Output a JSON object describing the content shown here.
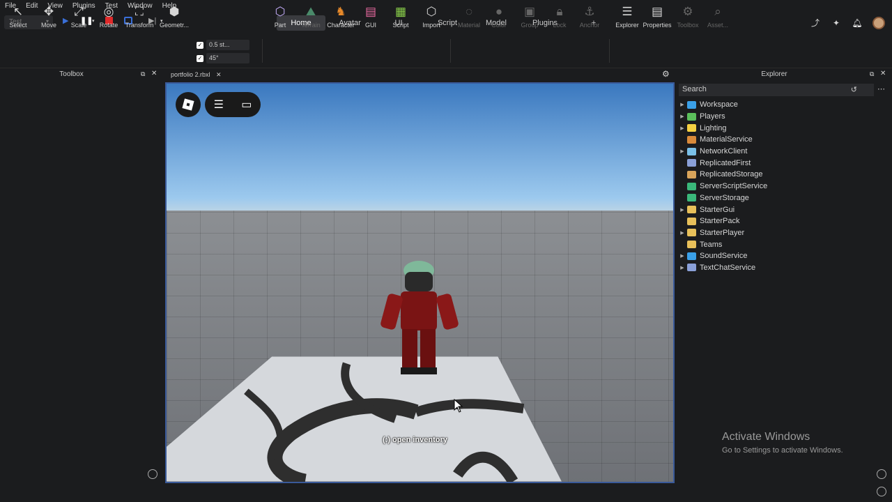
{
  "menu": [
    "File",
    "Edit",
    "View",
    "Plugins",
    "Test",
    "Window",
    "Help"
  ],
  "mode_select": "Test",
  "ribbon_tabs": [
    "Home",
    "Avatar",
    "UI",
    "Script",
    "Model",
    "Plugins"
  ],
  "ribbon_add": "+",
  "tools": {
    "select": "Select",
    "move": "Move",
    "scale": "Scale",
    "rotate": "Rotate",
    "transform": "Transform",
    "geometry": "Geometr...",
    "part": "Part",
    "terrain": "Terrain",
    "character": "Character",
    "gui": "GUI",
    "script": "Script",
    "import": "Import",
    "material": "Material",
    "color": "Color",
    "group": "Group",
    "lock": "Lock",
    "anchor": "Anchor",
    "explorer": "Explorer",
    "properties": "Properties",
    "toolbox": "Toolbox",
    "asset": "Asset..."
  },
  "snap": {
    "move_value": "0.5 st...",
    "rotate_value": "45°"
  },
  "toolbox_title": "Toolbox",
  "viewport_tab": "portfolio 2.rbxl",
  "viewport_prompt": "(:) open inventory",
  "explorer": {
    "title": "Explorer",
    "search_placeholder": "Search",
    "items": [
      {
        "label": "Workspace",
        "expandable": true,
        "color": "#3aa0e8"
      },
      {
        "label": "Players",
        "expandable": true,
        "color": "#5bbf5b"
      },
      {
        "label": "Lighting",
        "expandable": true,
        "color": "#f5d142"
      },
      {
        "label": "MaterialService",
        "expandable": false,
        "color": "#d98a3a"
      },
      {
        "label": "NetworkClient",
        "expandable": true,
        "color": "#7ac0e8"
      },
      {
        "label": "ReplicatedFirst",
        "expandable": false,
        "color": "#8aa0d8"
      },
      {
        "label": "ReplicatedStorage",
        "expandable": false,
        "color": "#d9a45a"
      },
      {
        "label": "ServerScriptService",
        "expandable": false,
        "color": "#3ab87a"
      },
      {
        "label": "ServerStorage",
        "expandable": false,
        "color": "#3ab87a"
      },
      {
        "label": "StarterGui",
        "expandable": true,
        "color": "#e8c05a"
      },
      {
        "label": "StarterPack",
        "expandable": false,
        "color": "#e8c05a"
      },
      {
        "label": "StarterPlayer",
        "expandable": true,
        "color": "#e8c05a"
      },
      {
        "label": "Teams",
        "expandable": false,
        "color": "#e8c05a"
      },
      {
        "label": "SoundService",
        "expandable": true,
        "color": "#3aa0e8"
      },
      {
        "label": "TextChatService",
        "expandable": true,
        "color": "#8aa0d8"
      }
    ]
  },
  "watermark": {
    "line1": "Activate Windows",
    "line2": "Go to Settings to activate Windows."
  }
}
